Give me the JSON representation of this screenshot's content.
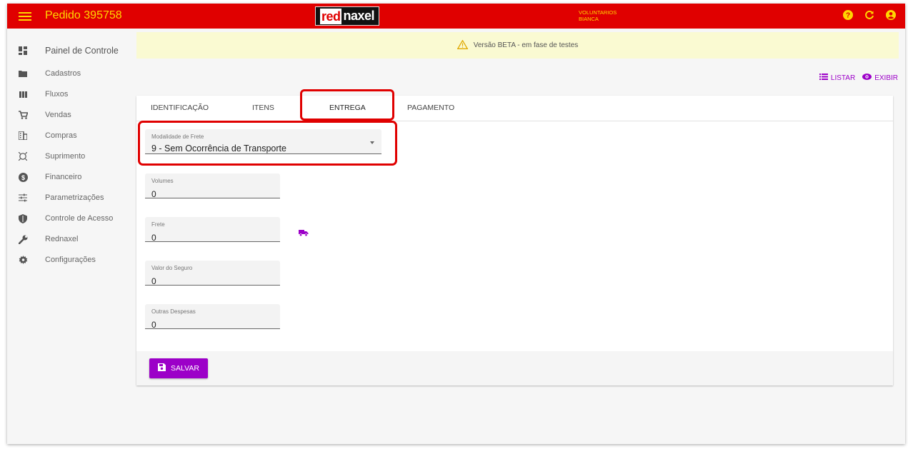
{
  "topbar": {
    "title": "Pedido 395758",
    "logo_red": "red",
    "logo_rest": "naxel",
    "user_line1": "VOLUNTARIOS",
    "user_line2": "BIANCA"
  },
  "sidebar": {
    "items": [
      {
        "label": "Painel de Controle",
        "icon": "dashboard-icon"
      },
      {
        "label": "Cadastros",
        "icon": "folder-icon"
      },
      {
        "label": "Fluxos",
        "icon": "columns-icon"
      },
      {
        "label": "Vendas",
        "icon": "cart-icon"
      },
      {
        "label": "Compras",
        "icon": "building-icon"
      },
      {
        "label": "Suprimento",
        "icon": "supply-icon"
      },
      {
        "label": "Financeiro",
        "icon": "money-icon"
      },
      {
        "label": "Parametrizações",
        "icon": "sliders-icon"
      },
      {
        "label": "Controle de Acesso",
        "icon": "shield-icon"
      },
      {
        "label": "Rednaxel",
        "icon": "wrench-icon"
      },
      {
        "label": "Configurações",
        "icon": "gear-icon"
      }
    ]
  },
  "banner": {
    "text": "Versão BETA - em fase de testes"
  },
  "actions": {
    "list_label": "LISTAR",
    "view_label": "EXIBIR"
  },
  "tabs": [
    "IDENTIFICAÇÃO",
    "ITENS",
    "ENTREGA",
    "PAGAMENTO"
  ],
  "active_tab": "ENTREGA",
  "form": {
    "freight_mode": {
      "label": "Modalidade de Frete",
      "value": "9 - Sem Ocorrência de Transporte"
    },
    "volumes": {
      "label": "Volumes",
      "value": "0"
    },
    "freight": {
      "label": "Frete",
      "value": "0"
    },
    "insurance": {
      "label": "Valor do Seguro",
      "value": "0"
    },
    "other_expenses": {
      "label": "Outras Despesas",
      "value": "0"
    }
  },
  "footer": {
    "save_label": "SALVAR"
  },
  "colors": {
    "topbar": "#e00000",
    "accent_yellow": "#ffd600",
    "purple": "#9c00c8",
    "highlight": "#e00000"
  }
}
